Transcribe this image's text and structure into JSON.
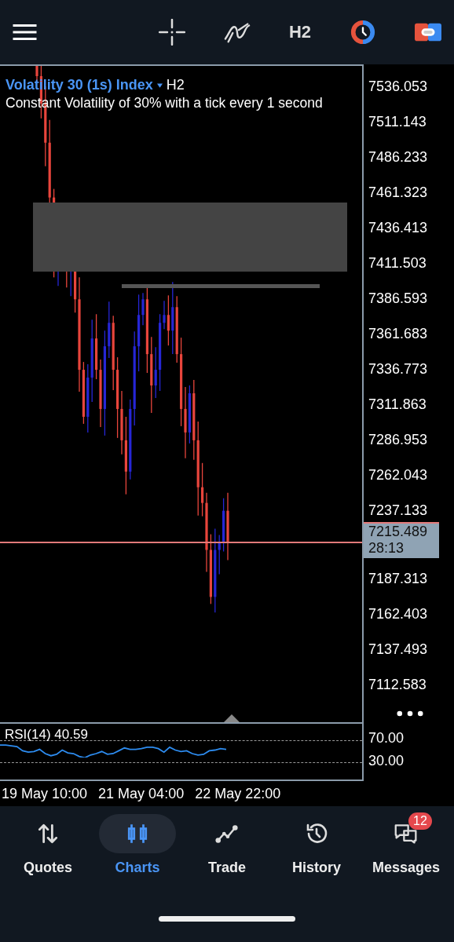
{
  "toolbar": {
    "timeframe": "H2"
  },
  "chart": {
    "symbol": "Volatility 30 (1s) Index",
    "timeframe": "H2",
    "description": "Constant Volatility of 30% with a tick every 1 second",
    "price_labels_above": [
      "7536.053",
      "7511.143",
      "7486.233",
      "7461.323",
      "7436.413",
      "7411.503",
      "7386.593",
      "7361.683",
      "7336.773",
      "7311.863",
      "7286.953",
      "7262.043",
      "7237.133"
    ],
    "current_price": {
      "price": "7215.489",
      "countdown": "28:13"
    },
    "price_labels_below": [
      "7187.313",
      "7162.403",
      "7137.493",
      "7112.583"
    ]
  },
  "rsi": {
    "label": "RSI(14) 40.59",
    "levels": [
      "70.00",
      "30.00"
    ]
  },
  "time_labels": [
    "19 May 10:00",
    "21 May 04:00",
    "22 May 22:00"
  ],
  "nav": [
    {
      "label": "Quotes",
      "selected": false
    },
    {
      "label": "Charts",
      "selected": true
    },
    {
      "label": "Trade",
      "selected": false
    },
    {
      "label": "History",
      "selected": false
    },
    {
      "label": "Messages",
      "selected": false,
      "badge": "12"
    }
  ]
}
